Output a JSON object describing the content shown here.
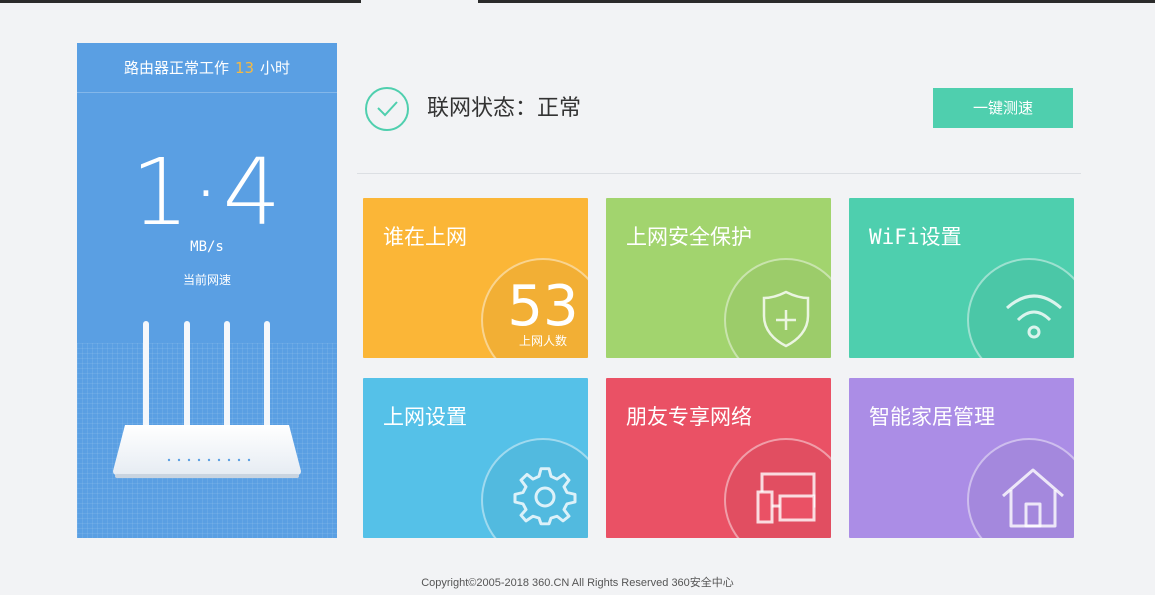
{
  "uptime": {
    "prefix": "路由器正常工作",
    "hours": "13",
    "suffix": "小时"
  },
  "speed": {
    "value": "1·4",
    "unit": "MB/s",
    "caption": "当前网速"
  },
  "status": {
    "label": "联网状态：正常",
    "speedtest_button": "一键测速"
  },
  "tiles": [
    {
      "title": "谁在上网",
      "count": "53",
      "count_label": "上网人数",
      "color": "#fbb637"
    },
    {
      "title": "上网安全保护",
      "icon": "shield-plus-icon",
      "color": "#a2d46e"
    },
    {
      "title": "WiFi设置",
      "icon": "wifi-icon",
      "color": "#4ecfae"
    },
    {
      "title": "上网设置",
      "icon": "gear-icon",
      "color": "#55c1e8"
    },
    {
      "title": "朋友专享网络",
      "icon": "devices-icon",
      "color": "#ea5165"
    },
    {
      "title": "智能家居管理",
      "icon": "house-icon",
      "color": "#ab8de6"
    }
  ],
  "footer": {
    "copyright": "Copyright©2005-2018 360.CN All Rights Reserved 360安全中心"
  }
}
